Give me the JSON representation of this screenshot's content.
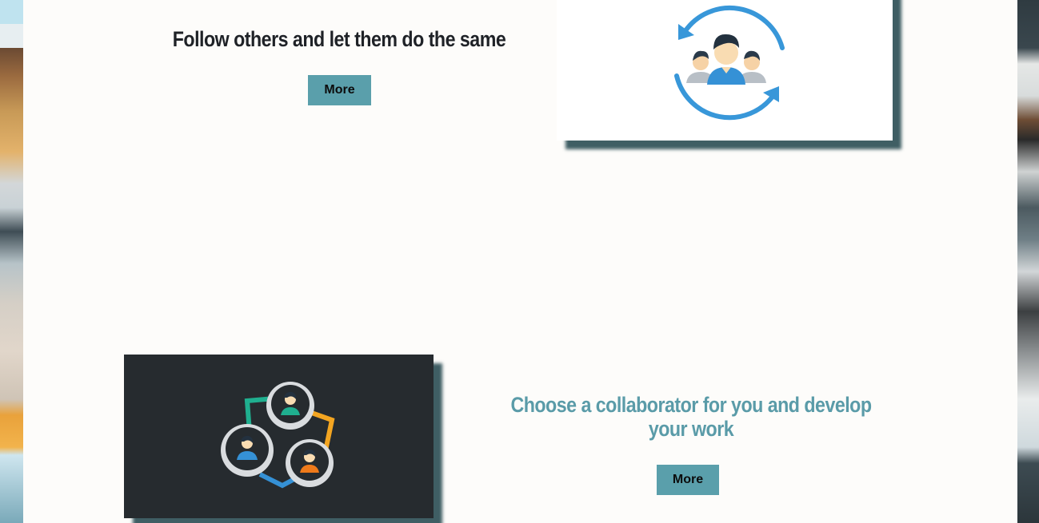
{
  "sections": [
    {
      "heading": "Follow others and let them do the same",
      "button_label": "More",
      "image_icon": "follow-users-cycle-icon"
    },
    {
      "heading": "Choose a collaborator for you and develop your work",
      "button_label": "More",
      "image_icon": "collaboration-network-icon"
    }
  ],
  "colors": {
    "accent": "#5a9fab",
    "heading_dark": "#1f2227",
    "heading_accent": "#5a9ba8",
    "dark_card": "#262b2f",
    "page_bg": "#fdfcfa"
  }
}
